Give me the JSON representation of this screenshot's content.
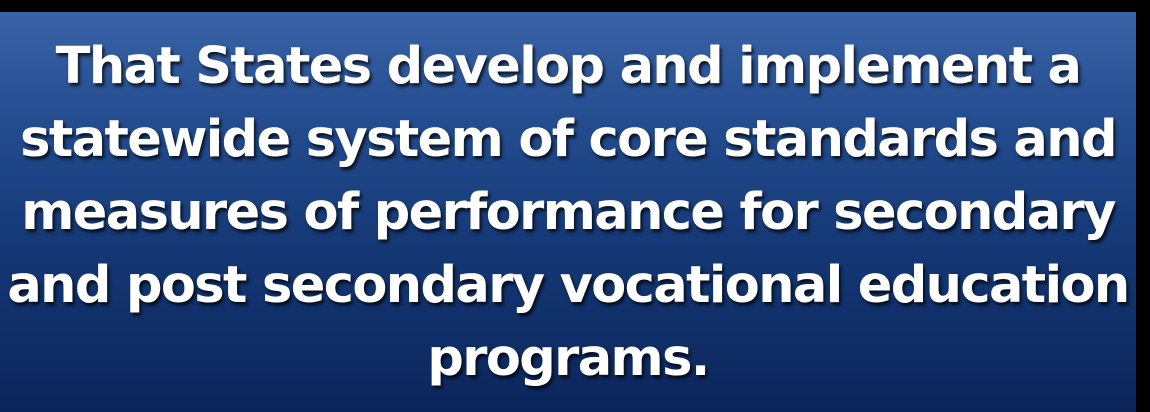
{
  "slide": {
    "background_colors": [
      "#3a63a8",
      "#0b255b"
    ],
    "text_color": "#ffffff",
    "statement_lines": [
      "That States develop and implement a",
      "statewide system of core standards and",
      "measures of performance for secondary",
      "and post secondary vocational education",
      "programs."
    ]
  }
}
